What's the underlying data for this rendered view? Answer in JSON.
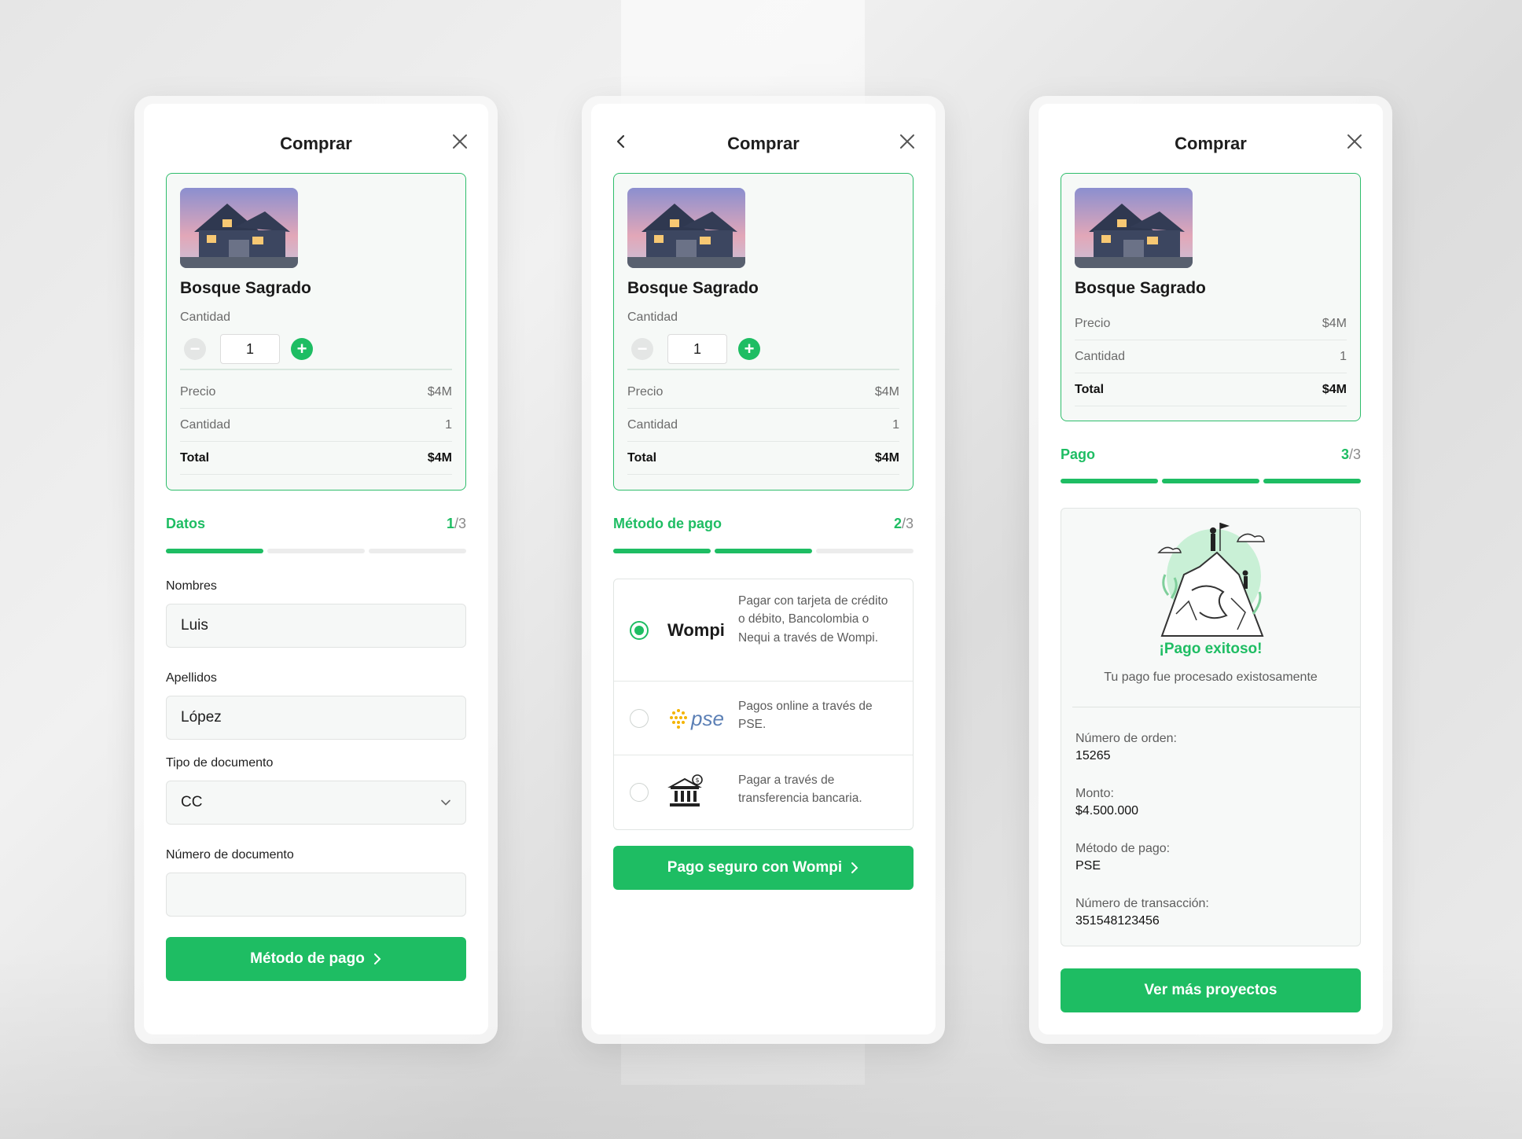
{
  "product": {
    "name": "Bosque Sagrado",
    "quantity_label": "Cantidad",
    "quantity_value": "1",
    "minus_symbol": "−",
    "plus_symbol": "+",
    "price_label": "Precio",
    "price_value": "$4M",
    "qty_row_label": "Cantidad",
    "qty_row_value": "1",
    "total_label": "Total",
    "total_value": "$4M"
  },
  "screens": {
    "datos": {
      "title": "Comprar",
      "step_name": "Datos",
      "step_current": "1",
      "step_total": "/3",
      "progress": 0.333,
      "fields": {
        "nombres_label": "Nombres",
        "nombres_value": "Luis",
        "apellidos_label": "Apellidos",
        "apellidos_value": "López",
        "tipo_label": "Tipo de documento",
        "tipo_value": "CC",
        "numero_label": "Número de documento",
        "numero_value": ""
      },
      "button": "Método de pago"
    },
    "metodo": {
      "title": "Comprar",
      "step_name": "Método de pago",
      "step_current": "2",
      "step_total": "/3",
      "progress": 0.667,
      "options": [
        {
          "logo": "Wompi",
          "desc": "Pagar con tarjeta de crédito o débito, Bancolombia o Nequi a través de Wompi.",
          "selected": true
        },
        {
          "logo": "pse",
          "desc": "Pagos online a través de PSE.",
          "selected": false
        },
        {
          "logo": "bank-icon",
          "desc": "Pagar a través de transferencia bancaria.",
          "selected": false
        }
      ],
      "button": "Pago seguro con Wompi"
    },
    "pago": {
      "title": "Comprar",
      "step_name": "Pago",
      "step_current": "3",
      "step_total": "/3",
      "progress": 1.0,
      "success_title": "¡Pago exitoso!",
      "success_sub": "Tu pago fue procesado existosamente",
      "order_label": "Número de orden:",
      "order_value": "15265",
      "amount_label": "Monto:",
      "amount_value": "$4.500.000",
      "method_label": "Método de pago:",
      "method_value": "PSE",
      "txn_label": "Número de transacción:",
      "txn_value": "351548123456",
      "button": "Ver más proyectos"
    }
  },
  "colors": {
    "accent": "#1ebd63",
    "card_border": "#2ebd6b",
    "text": "#1d1d1d",
    "muted": "#6b6b6b"
  }
}
